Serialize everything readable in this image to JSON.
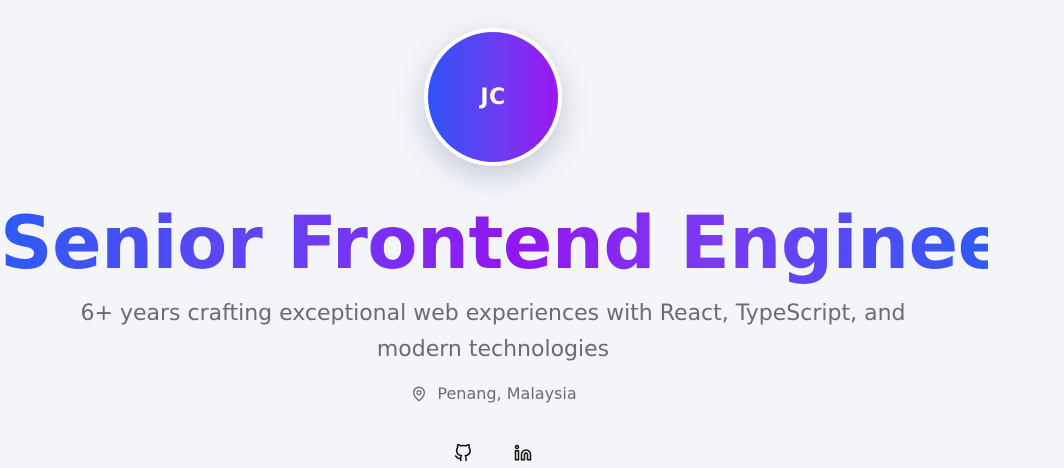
{
  "profile": {
    "initials": "JC",
    "headline": "Senior Frontend Engineer",
    "subtitle": "6+ years crafting exceptional web experiences with React, TypeScript, and modern technologies",
    "location": "Penang, Malaysia"
  },
  "icons": {
    "location": "map-pin-icon",
    "github": "github-icon",
    "linkedin": "linkedin-icon"
  },
  "colors": {
    "background": "#f3f5f9",
    "gradient_start": "#2b5bf6",
    "gradient_mid": "#9316f2",
    "text_muted": "#6b6b74"
  }
}
